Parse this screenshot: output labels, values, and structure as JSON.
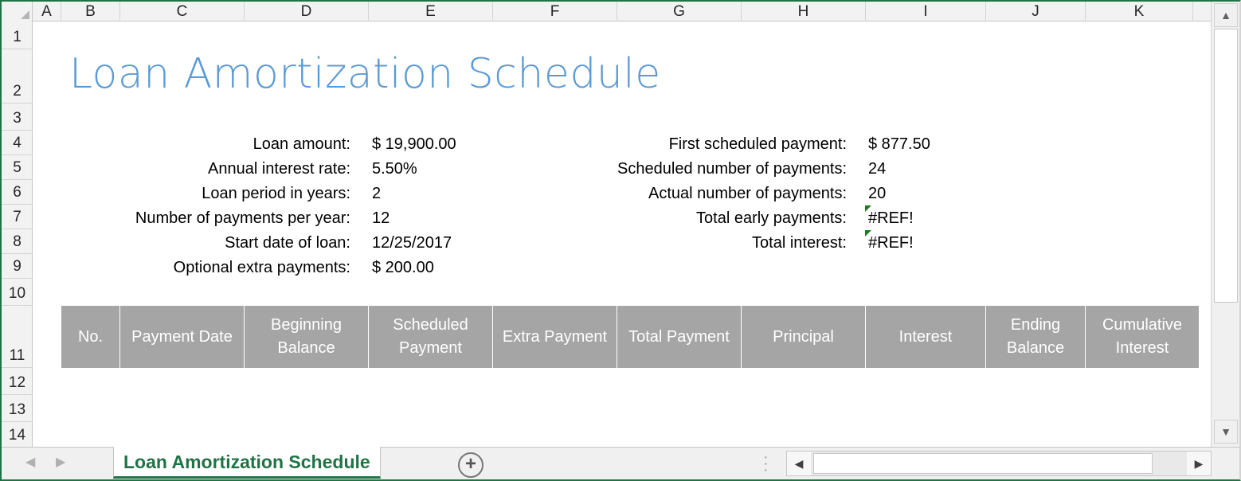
{
  "columns": [
    "A",
    "B",
    "C",
    "D",
    "E",
    "F",
    "G",
    "H",
    "I",
    "J",
    "K"
  ],
  "rows": [
    "1",
    "2",
    "3",
    "4",
    "5",
    "6",
    "7",
    "8",
    "9",
    "10",
    "11",
    "12",
    "13",
    "14"
  ],
  "title": "Loan Amortization Schedule",
  "inputs": [
    {
      "label": "Loan amount:",
      "value": "$ 19,900.00"
    },
    {
      "label": "Annual interest rate:",
      "value": "5.50%"
    },
    {
      "label": "Loan period in years:",
      "value": "2"
    },
    {
      "label": "Number of payments per year:",
      "value": "12"
    },
    {
      "label": "Start date of loan:",
      "value": "12/25/2017"
    },
    {
      "label": "Optional extra payments:",
      "value": "$ 200.00"
    }
  ],
  "summary": [
    {
      "label": "First scheduled payment:",
      "value": "$ 877.50"
    },
    {
      "label": "Scheduled number of payments:",
      "value": "24"
    },
    {
      "label": "Actual number of payments:",
      "value": "20"
    },
    {
      "label": "Total early payments:",
      "value": "#REF!"
    },
    {
      "label": "Total interest:",
      "value": "#REF!"
    }
  ],
  "table_headers": [
    "No.",
    "Payment Date",
    "Beginning\nBalance",
    "Scheduled\nPayment",
    "Extra Payment",
    "Total Payment",
    "Principal",
    "Interest",
    "Ending\nBalance",
    "Cumulative\nInterest"
  ],
  "sheet_tab": "Loan Amortization Schedule",
  "add_sheet_symbol": "+",
  "icons": {
    "scroll_up": "▲",
    "scroll_down": "▼",
    "scroll_left": "◀",
    "scroll_right": "▶",
    "tab_prev": "◀",
    "tab_next": "▶"
  },
  "colors": {
    "accent": "#217346",
    "title": "#5b9bd5",
    "table_header_bg": "#a5a5a5",
    "error_indicator": "#1e7b1e"
  }
}
